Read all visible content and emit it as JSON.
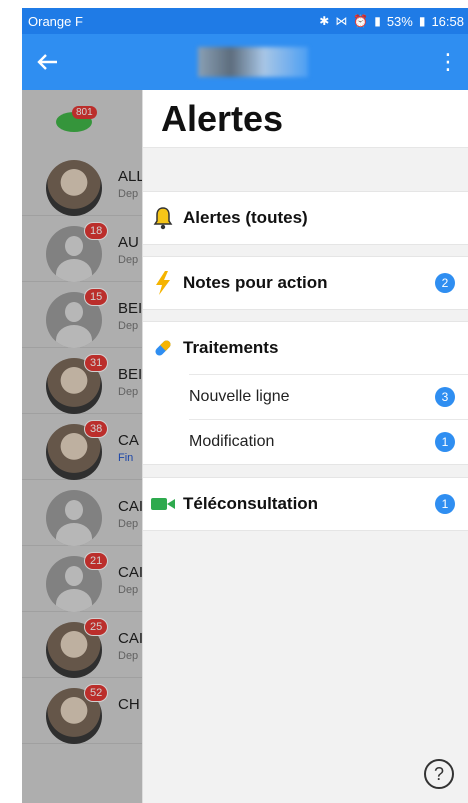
{
  "status_bar": {
    "carrier": "Orange F",
    "icons": [
      "bluetooth-icon",
      "vibrate-icon",
      "alarm-icon",
      "4g-icon",
      "signal-icon"
    ],
    "battery": "53%",
    "time": "16:58"
  },
  "app_bar": {
    "back_icon": "arrow-left-icon",
    "menu_icon": "more-vert-icon"
  },
  "left_list": {
    "chat_count": "801",
    "rows": [
      {
        "name": "ALL",
        "sub": "Dep",
        "badge": ""
      },
      {
        "name": "AU",
        "sub": "Dep",
        "badge": "18"
      },
      {
        "name": "BEI",
        "sub": "Dep",
        "badge": "15"
      },
      {
        "name": "BEI",
        "sub": "Dep",
        "badge": "31"
      },
      {
        "name": "CA",
        "sub": "Fin",
        "badge": "38"
      },
      {
        "name": "CAI",
        "sub": "Dep",
        "badge": ""
      },
      {
        "name": "CAI",
        "sub": "Dep",
        "badge": "21"
      },
      {
        "name": "CAI",
        "sub": "Dep",
        "badge": "25"
      },
      {
        "name": "CH",
        "sub": "",
        "badge": "52"
      }
    ]
  },
  "drawer": {
    "title": "Alertes",
    "all_alerts": "Alertes (toutes)",
    "notes_action": {
      "label": "Notes pour action",
      "count": "2"
    },
    "traitements": {
      "label": "Traitements",
      "items": [
        {
          "label": "Nouvelle ligne",
          "count": "3"
        },
        {
          "label": "Modification",
          "count": "1"
        }
      ]
    },
    "teleconsultation": {
      "label": "Téléconsultation",
      "count": "1"
    },
    "help": "?"
  },
  "colors": {
    "app_bar": "#2f8ef1",
    "status_bar": "#1f7be6",
    "badge_blue": "#2f8ef1",
    "badge_red": "#e53935"
  }
}
